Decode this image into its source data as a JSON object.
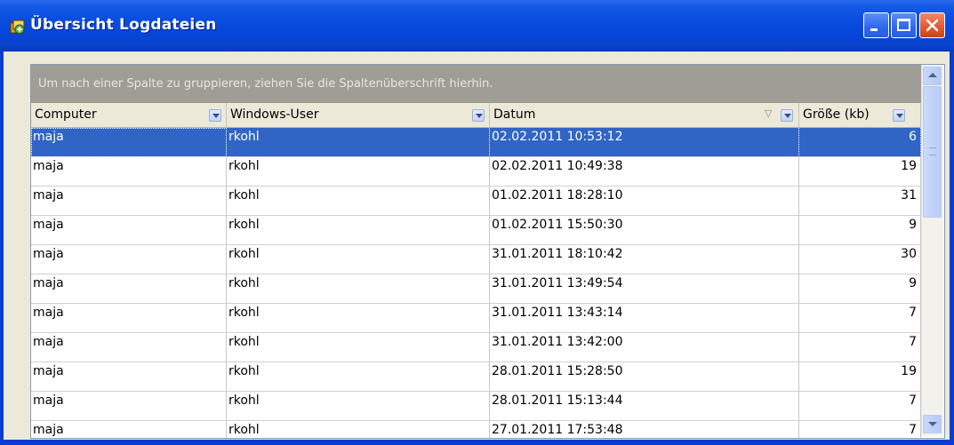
{
  "window": {
    "title": "Übersicht Logdateien"
  },
  "grid": {
    "group_hint": "Um nach einer Spalte zu gruppieren, ziehen Sie die Spaltenüberschrift hierhin.",
    "columns": [
      "Computer",
      "Windows-User",
      "Datum",
      "Größe (kb)"
    ],
    "sorted_column": "Datum",
    "sort_direction": "descending",
    "selected_row": 0,
    "rows": [
      [
        "maja",
        "rkohl",
        "02.02.2011 10:53:12",
        "6"
      ],
      [
        "maja",
        "rkohl",
        "02.02.2011 10:49:38",
        "19"
      ],
      [
        "maja",
        "rkohl",
        "01.02.2011 18:28:10",
        "31"
      ],
      [
        "maja",
        "rkohl",
        "01.02.2011 15:50:30",
        "9"
      ],
      [
        "maja",
        "rkohl",
        "31.01.2011 18:10:42",
        "30"
      ],
      [
        "maja",
        "rkohl",
        "31.01.2011 13:49:54",
        "9"
      ],
      [
        "maja",
        "rkohl",
        "31.01.2011 13:43:14",
        "7"
      ],
      [
        "maja",
        "rkohl",
        "31.01.2011 13:42:00",
        "7"
      ],
      [
        "maja",
        "rkohl",
        "28.01.2011 15:28:50",
        "19"
      ],
      [
        "maja",
        "rkohl",
        "28.01.2011 15:13:44",
        "7"
      ],
      [
        "maja",
        "rkohl",
        "27.01.2011 17:53:48",
        "7"
      ]
    ]
  },
  "colors": {
    "selection": "#3165c5",
    "titlebar": "#0a4fe0",
    "group_panel": "#a09d96"
  },
  "icons": [
    "app-icon",
    "minimize-icon",
    "maximize-icon",
    "close-icon",
    "filter-dropdown-icon",
    "sort-descending-icon",
    "scroll-up-icon",
    "scroll-down-icon"
  ]
}
